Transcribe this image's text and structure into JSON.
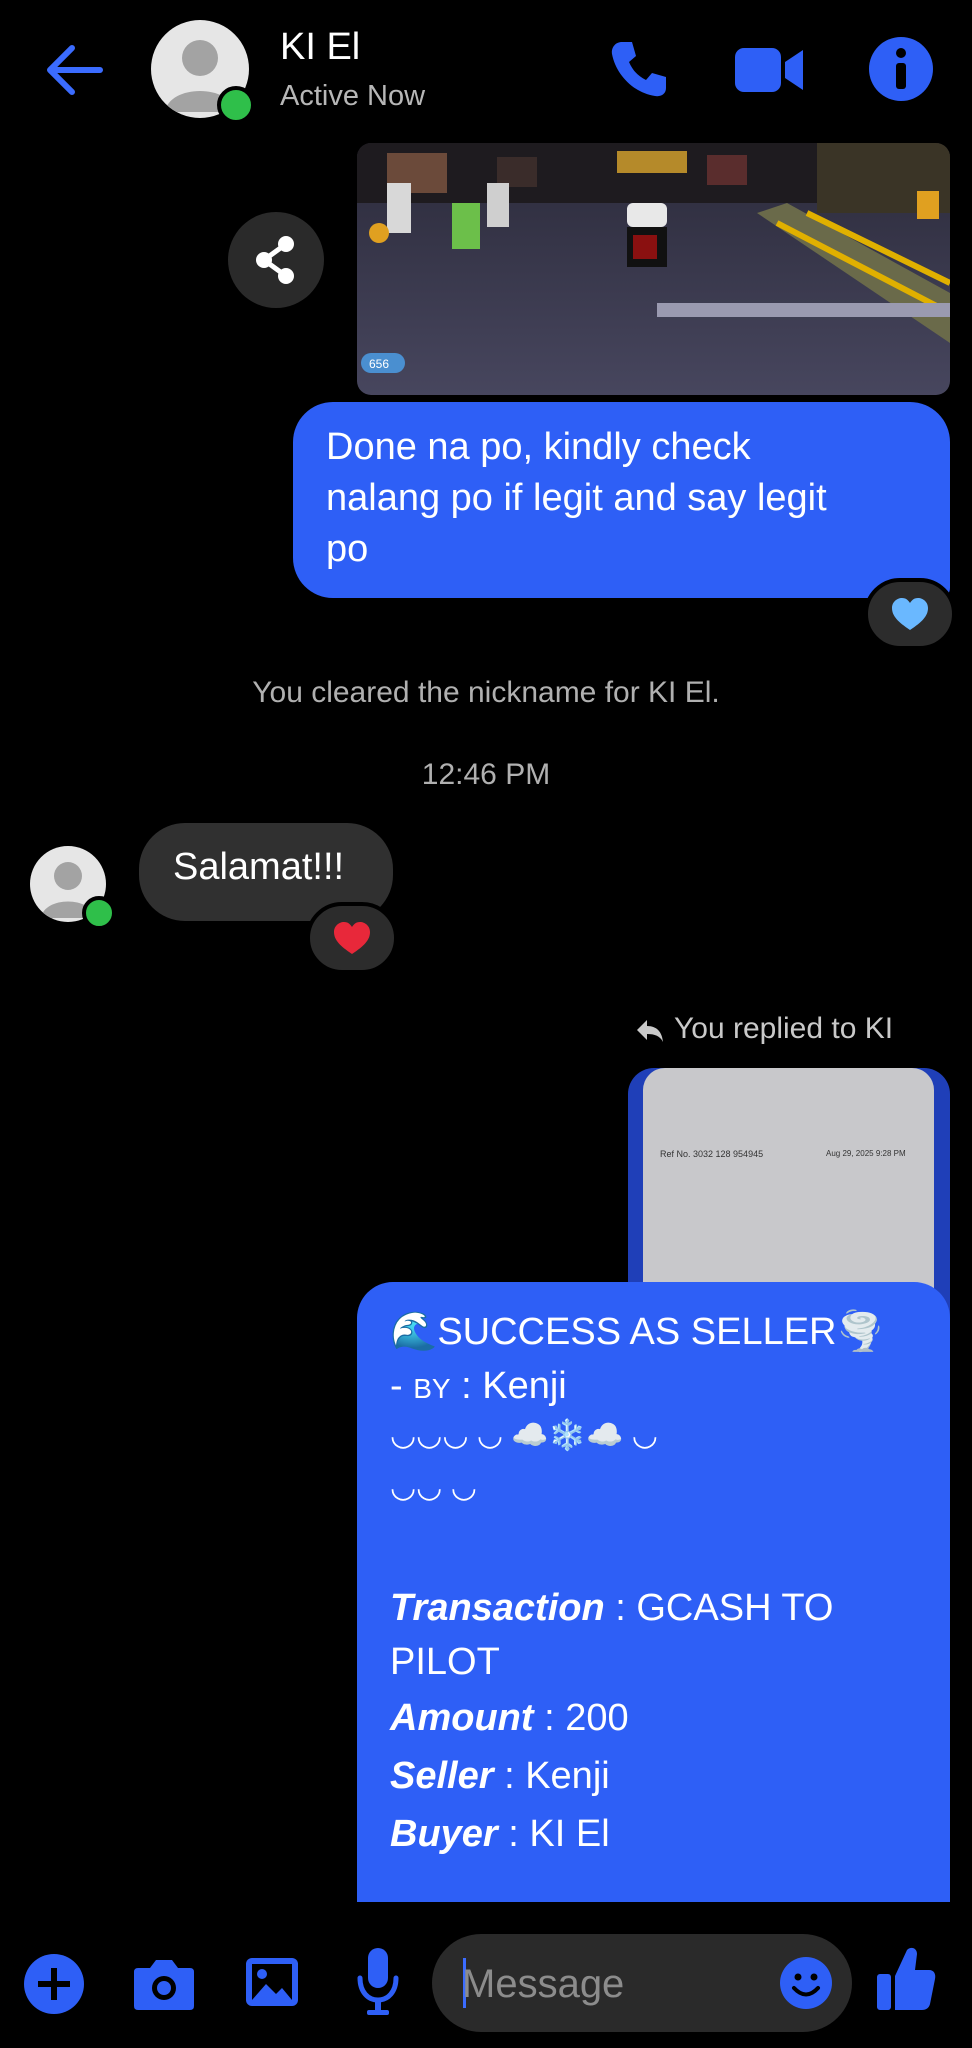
{
  "header": {
    "contact_name": "KI El",
    "status": "Active Now"
  },
  "icons": {
    "back": "arrow-left-icon",
    "call": "phone-icon",
    "video": "video-camera-icon",
    "info": "info-icon",
    "share": "share-icon"
  },
  "messages": {
    "sent_1": "Done na po, kindly check\nnalang po if legit and say legit\npo",
    "system_note": "You cleared the nickname for KI El.",
    "timestamp": "12:46 PM",
    "received_1": "Salamat!!!",
    "reply_label": "You replied to KI",
    "quoted_ref": "Ref No. 3032 128 954945",
    "quoted_date": "Aug 29, 2025 9:28 PM"
  },
  "receipt": {
    "title": "SUCCESS AS SELLER",
    "by_prefix": "- ",
    "by_label": "BY",
    "by_value": " : Kenji",
    "deco_line_1": "◡◡◡ ◡  ☁️❄️☁️  ◡",
    "deco_line_2": "◡◡ ◡",
    "transaction_label": "Transaction",
    "transaction_value": " : GCASH TO",
    "transaction_value_2": "PILOT",
    "amount_label": "Amount",
    "amount_value": " : 200",
    "seller_label": "Seller",
    "seller_value": " : Kenji",
    "buyer_label": "Buyer",
    "buyer_value": " : KI El"
  },
  "composer": {
    "placeholder": "Message"
  },
  "colors": {
    "accent": "#2e5ff6",
    "background": "#000000",
    "received_bubble": "#303030",
    "online": "#2fbf4a"
  }
}
